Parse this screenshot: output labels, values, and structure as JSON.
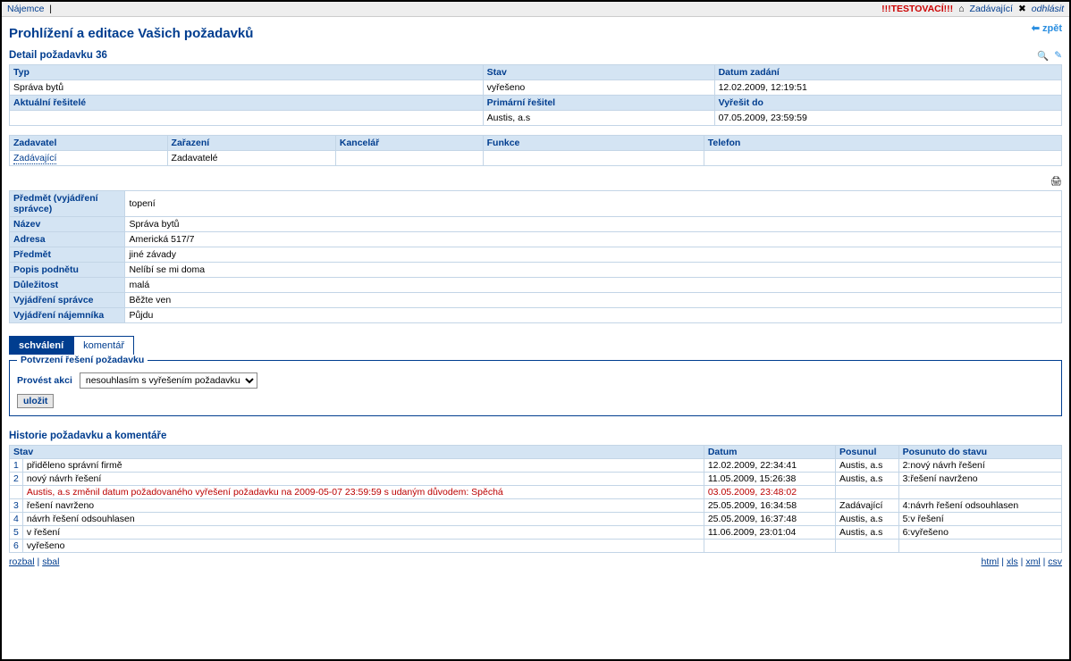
{
  "topbar": {
    "left_link": "Nájemce",
    "test_label": "!!!TESTOVACÍ!!!",
    "user_link": "Zadávající",
    "logout": "odhlásit"
  },
  "header": {
    "title": "Prohlížení a editace Vašich požadavků",
    "back": "zpět",
    "subtitle": "Detail požadavku 36"
  },
  "detail1": {
    "typ_h": "Typ",
    "typ_v": "Správa bytů",
    "stav_h": "Stav",
    "stav_v": "vyřešeno",
    "datumz_h": "Datum zadání",
    "datumz_v": "12.02.2009, 12:19:51",
    "res_h": "Aktuální řešitelé",
    "res_v": "",
    "prim_h": "Primární řešitel",
    "prim_v": "Austis, a.s",
    "vyr_h": "Vyřešit do",
    "vyr_v": "07.05.2009, 23:59:59",
    "zad_h": "Zadavatel",
    "zad_v": "Zadávající",
    "zar_h": "Zařazení",
    "zar_v": "Zadavatelé",
    "kan_h": "Kancelář",
    "kan_v": "",
    "fun_h": "Funkce",
    "fun_v": "",
    "tel_h": "Telefon",
    "tel_v": ""
  },
  "detail2": {
    "predspr_h": "Předmět (vyjádření správce)",
    "predspr_v": "topení",
    "nazev_h": "Název",
    "nazev_v": "Správa bytů",
    "adresa_h": "Adresa",
    "adresa_v": "Americká 517/7",
    "predmet_h": "Předmět",
    "predmet_v": "jiné závady",
    "popis_h": "Popis podnětu",
    "popis_v": "Nelíbí se mi doma",
    "dul_h": "Důležitost",
    "dul_v": "malá",
    "vyjspr_h": "Vyjádření správce",
    "vyjspr_v": "Běžte ven",
    "vyjnaj_h": "Vyjádření nájemníka",
    "vyjnaj_v": "Půjdu"
  },
  "tabs": {
    "tab1": "schválení",
    "tab2": "komentář"
  },
  "form": {
    "legend": "Potvrzení řešení požadavku",
    "label": "Provést akci",
    "select_value": "nesouhlasím s vyřešením požadavku",
    "save": "uložit"
  },
  "history": {
    "title": "Historie požadavku a komentáře",
    "h_stav": "Stav",
    "h_datum": "Datum",
    "h_posunul": "Posunul",
    "h_posunuto": "Posunuto do stavu",
    "rows": [
      {
        "n": "1",
        "stav": "přiděleno správní firmě",
        "datum": "12.02.2009, 22:34:41",
        "posunul": "Austis, a.s",
        "posunuto": "2:nový návrh řešení"
      },
      {
        "n": "2",
        "stav": "nový návrh řešení",
        "datum": "11.05.2009, 15:26:38",
        "posunul": "Austis, a.s",
        "posunuto": "3:řešení navrženo"
      },
      {
        "n": "",
        "stav": "Austis, a.s změnil datum požadovaného vyřešení požadavku na 2009-05-07 23:59:59 s udaným důvodem: Spěchá",
        "datum": "03.05.2009, 23:48:02",
        "posunul": "",
        "posunuto": "",
        "red": true
      },
      {
        "n": "3",
        "stav": "řešení navrženo",
        "datum": "25.05.2009, 16:34:58",
        "posunul": "Zadávající",
        "posunuto": "4:návrh řešení odsouhlasen"
      },
      {
        "n": "4",
        "stav": "návrh řešení odsouhlasen",
        "datum": "25.05.2009, 16:37:48",
        "posunul": "Austis, a.s",
        "posunuto": "5:v řešení"
      },
      {
        "n": "5",
        "stav": "v řešení",
        "datum": "11.06.2009, 23:01:04",
        "posunul": "Austis, a.s",
        "posunuto": "6:vyřešeno"
      },
      {
        "n": "6",
        "stav": "vyřešeno",
        "datum": "",
        "posunul": "",
        "posunuto": ""
      }
    ]
  },
  "footer": {
    "rozbal": "rozbal",
    "sbal": "sbal",
    "html": "html",
    "xls": "xls",
    "xml": "xml",
    "csv": "csv"
  }
}
